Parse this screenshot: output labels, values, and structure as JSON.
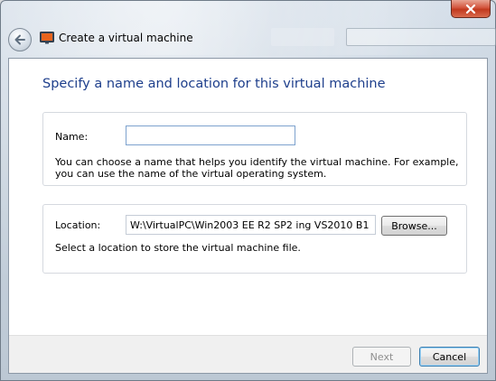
{
  "window": {
    "title": "Create a virtual machine",
    "close_icon": "close-icon",
    "back_icon": "back-arrow-icon",
    "app_icon": "virtual-pc-icon"
  },
  "page": {
    "heading": "Specify a name and location for this virtual machine"
  },
  "name_section": {
    "label": "Name:",
    "value": "",
    "description_line1": "You can choose a name that helps you identify the virtual machine. For example,",
    "description_line2": "you can use the name of the virtual operating system."
  },
  "location_section": {
    "label": "Location:",
    "value": "W:\\VirtualPC\\Win2003 EE R2 SP2 ing VS2010 B1",
    "browse_label": "Browse...",
    "description": "Select a location to store the virtual machine file."
  },
  "footer": {
    "next_label": "Next",
    "next_enabled": false,
    "cancel_label": "Cancel"
  },
  "colors": {
    "heading": "#1e3f8c",
    "close_button": "#c1391e",
    "input_focus_border": "#7da2ce"
  }
}
